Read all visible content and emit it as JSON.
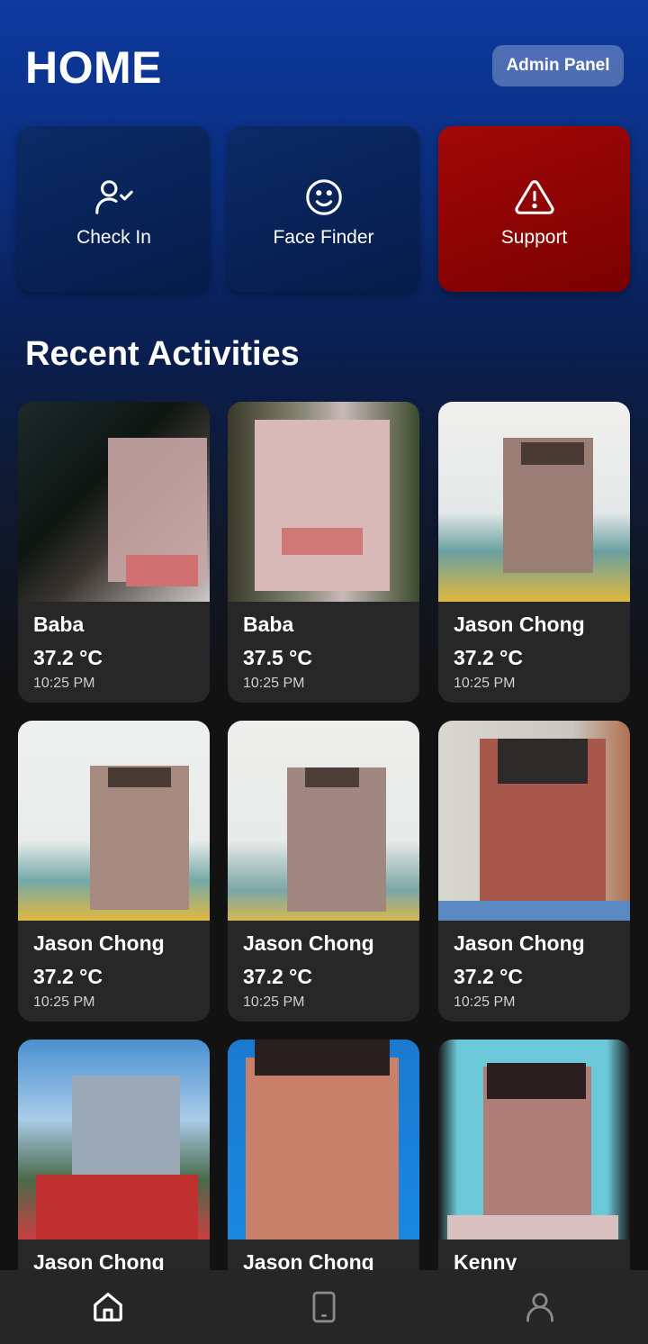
{
  "header": {
    "title": "HOME",
    "admin_label": "Admin Panel"
  },
  "actions": [
    {
      "label": "Check In",
      "icon": "user-check-icon",
      "color": "#0b2a66"
    },
    {
      "label": "Face Finder",
      "icon": "smile-icon",
      "color": "#0b2a66"
    },
    {
      "label": "Support",
      "icon": "warning-icon",
      "color": "#a30808"
    }
  ],
  "recent": {
    "title": "Recent Activities",
    "items": [
      {
        "name": "Baba",
        "temp": "37.2 °C",
        "time": "10:25 PM"
      },
      {
        "name": "Baba",
        "temp": "37.5 °C",
        "time": "10:25 PM"
      },
      {
        "name": "Jason Chong",
        "temp": "37.2 °C",
        "time": "10:25 PM"
      },
      {
        "name": "Jason Chong",
        "temp": "37.2 °C",
        "time": "10:25 PM"
      },
      {
        "name": "Jason Chong",
        "temp": "37.2 °C",
        "time": "10:25 PM"
      },
      {
        "name": "Jason Chong",
        "temp": "37.2 °C",
        "time": "10:25 PM"
      },
      {
        "name": "Jason Chong",
        "temp": "",
        "time": ""
      },
      {
        "name": "Jason Chong",
        "temp": "",
        "time": ""
      },
      {
        "name": "Kenny",
        "temp": "",
        "time": ""
      }
    ]
  },
  "nav": [
    {
      "icon": "home-icon",
      "active": true
    },
    {
      "icon": "tablet-icon",
      "active": false
    },
    {
      "icon": "profile-icon",
      "active": false
    }
  ],
  "colors": {
    "background": "#121212",
    "card": "#272727",
    "support": "#a30808",
    "admin": "#6a7fb0"
  }
}
